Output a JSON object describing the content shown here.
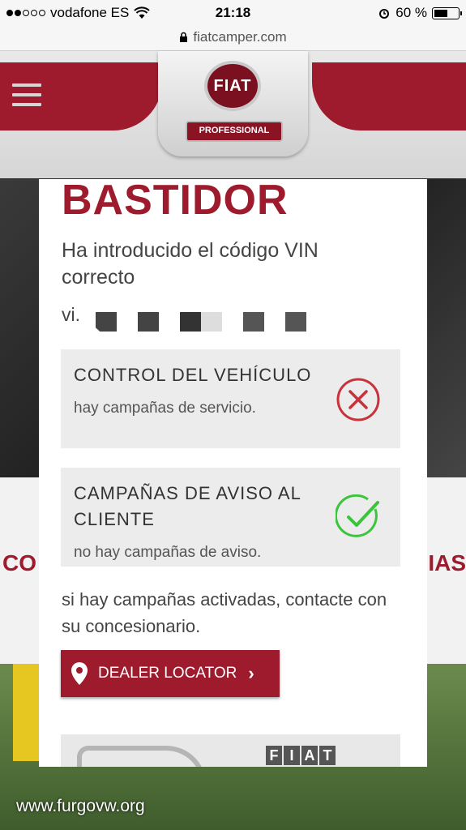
{
  "status_bar": {
    "carrier": "vodafone ES",
    "time": "21:18",
    "battery": "60 %",
    "battery_level": 0.6
  },
  "url_bar": {
    "url": "fiatcamper.com"
  },
  "header": {
    "logo_text": "FIAT",
    "sub_logo_text": "PROFESSIONAL"
  },
  "background": {
    "left_text": "CO",
    "right_text": "IAS",
    "watermark": "www.furgovw.org"
  },
  "modal": {
    "title": "BASTIDOR",
    "intro": "Ha introducido el código VIN correcto",
    "vin_prefix": "vi.",
    "cards": [
      {
        "title": "CONTROL DEL VEHÍCULO",
        "desc": "hay campañas de servicio.",
        "status": "error",
        "status_icon": "x-circle-icon"
      },
      {
        "title": "CAMPAÑAS DE AVISO AL CLIENTE",
        "desc": "no hay campañas de aviso.",
        "status": "ok",
        "status_icon": "check-circle-icon"
      }
    ],
    "note": "si hay campañas activadas, contacte con su concesionario.",
    "dealer_button": "DEALER LOCATOR",
    "banner_brand": "FIAT"
  },
  "colors": {
    "brand": "#9e1b2d",
    "error": "#c8323a",
    "ok": "#3cc43c"
  }
}
